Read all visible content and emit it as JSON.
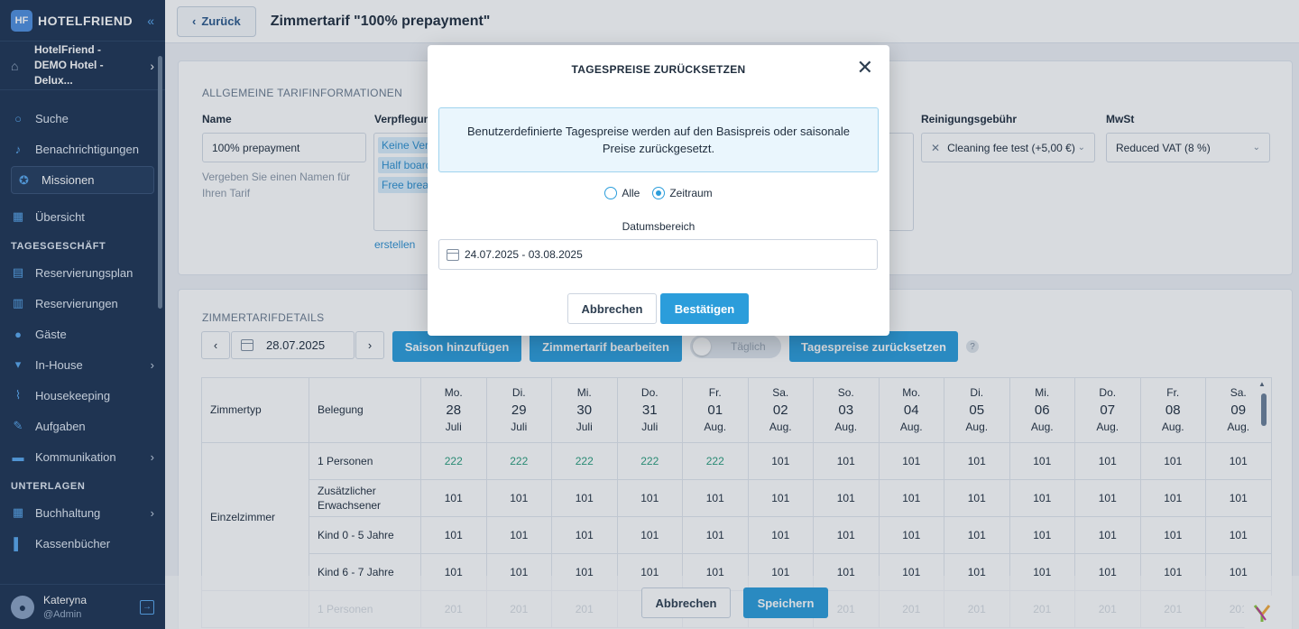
{
  "app": {
    "logo_text": "HOTELFRIEND",
    "logo_mark": "HF"
  },
  "hotel": {
    "name": "HotelFriend - DEMO Hotel - Delux..."
  },
  "sidebar": {
    "items": [
      {
        "label": "Suche",
        "icon": "search-icon"
      },
      {
        "label": "Benachrichtigungen",
        "icon": "bell-icon"
      }
    ],
    "missions_label": "Missionen",
    "overview_label": "Übersicht",
    "section_daily": "TAGESGESCHÄFT",
    "daily_items": [
      {
        "label": "Reservierungsplan"
      },
      {
        "label": "Reservierungen"
      },
      {
        "label": "Gäste"
      },
      {
        "label": "In-House"
      },
      {
        "label": "Housekeeping"
      },
      {
        "label": "Aufgaben"
      },
      {
        "label": "Kommunikation"
      }
    ],
    "section_docs": "UNTERLAGEN",
    "doc_items": [
      {
        "label": "Buchhaltung"
      },
      {
        "label": "Kassenbücher"
      }
    ]
  },
  "user": {
    "name": "Kateryna",
    "role": "@Admin"
  },
  "topbar": {
    "back_label": "Zurück",
    "title": "Zimmertarif \"100% prepayment\""
  },
  "general": {
    "section_title": "ALLGEMEINE TARIFINFORMATIONEN",
    "name_label": "Name",
    "name_value": "100% prepayment",
    "name_hint": "Vergeben Sie einen Namen für Ihren Tarif",
    "meal_label": "Verpflegung",
    "meal_tags": [
      "Keine Verpflegung",
      "Half board",
      "Free breakfast"
    ],
    "create_link": "erstellen",
    "cleaning_label": "Reinigungsgebühr",
    "cleaning_value": "Cleaning fee test (+5,00 €)",
    "vat_label": "MwSt",
    "vat_value": "Reduced VAT (8 %)"
  },
  "details": {
    "section_title": "ZIMMERTARIFDETAILS",
    "date": "28.07.2025",
    "btn_season": "Saison hinzufügen",
    "btn_edit": "Zimmertarif bearbeiten",
    "toggle_label": "Täglich",
    "btn_reset": "Tagespreise zurücksetzen",
    "help": "?"
  },
  "table": {
    "col_roomtype": "Zimmertyp",
    "col_occupancy": "Belegung",
    "days": [
      {
        "dow": "Mo.",
        "day": "28",
        "month": "Juli"
      },
      {
        "dow": "Di.",
        "day": "29",
        "month": "Juli"
      },
      {
        "dow": "Mi.",
        "day": "30",
        "month": "Juli"
      },
      {
        "dow": "Do.",
        "day": "31",
        "month": "Juli"
      },
      {
        "dow": "Fr.",
        "day": "01",
        "month": "Aug."
      },
      {
        "dow": "Sa.",
        "day": "02",
        "month": "Aug."
      },
      {
        "dow": "So.",
        "day": "03",
        "month": "Aug."
      },
      {
        "dow": "Mo.",
        "day": "04",
        "month": "Aug."
      },
      {
        "dow": "Di.",
        "day": "05",
        "month": "Aug."
      },
      {
        "dow": "Mi.",
        "day": "06",
        "month": "Aug."
      },
      {
        "dow": "Do.",
        "day": "07",
        "month": "Aug."
      },
      {
        "dow": "Fr.",
        "day": "08",
        "month": "Aug."
      },
      {
        "dow": "Sa.",
        "day": "09",
        "month": "Aug."
      }
    ],
    "room_type": "Einzelzimmer",
    "rows": [
      {
        "label": "1 Personen",
        "values": [
          "222",
          "222",
          "222",
          "222",
          "222",
          "101",
          "101",
          "101",
          "101",
          "101",
          "101",
          "101",
          "101"
        ]
      },
      {
        "label": "Zusätzlicher Erwachsener",
        "values": [
          "101",
          "101",
          "101",
          "101",
          "101",
          "101",
          "101",
          "101",
          "101",
          "101",
          "101",
          "101",
          "101"
        ]
      },
      {
        "label": "Kind 0 - 5 Jahre",
        "values": [
          "101",
          "101",
          "101",
          "101",
          "101",
          "101",
          "101",
          "101",
          "101",
          "101",
          "101",
          "101",
          "101"
        ]
      },
      {
        "label": "Kind 6 - 7 Jahre",
        "values": [
          "101",
          "101",
          "101",
          "101",
          "101",
          "101",
          "101",
          "101",
          "101",
          "101",
          "101",
          "101",
          "101"
        ]
      },
      {
        "label": "1 Personen",
        "values": [
          "201",
          "201",
          "201",
          "201",
          "201",
          "201",
          "201",
          "201",
          "201",
          "201",
          "201",
          "201",
          "201"
        ]
      }
    ]
  },
  "bottom": {
    "cancel": "Abbrechen",
    "save": "Speichern"
  },
  "modal": {
    "title": "TAGESPREISE ZURÜCKSETZEN",
    "info": "Benutzerdefinierte Tagespreise werden auf den Basispreis oder saisonale Preise zurückgesetzt.",
    "radio_all": "Alle",
    "radio_range": "Zeitraum",
    "selected": "Zeitraum",
    "range_label": "Datumsbereich",
    "range_value": "24.07.2025 - 03.08.2025",
    "cancel": "Abbrechen",
    "confirm": "Bestätigen"
  },
  "colors": {
    "sidebar": "#1e3454",
    "accent": "#2b9ddb",
    "highlight_value": "#2a9d7c"
  }
}
